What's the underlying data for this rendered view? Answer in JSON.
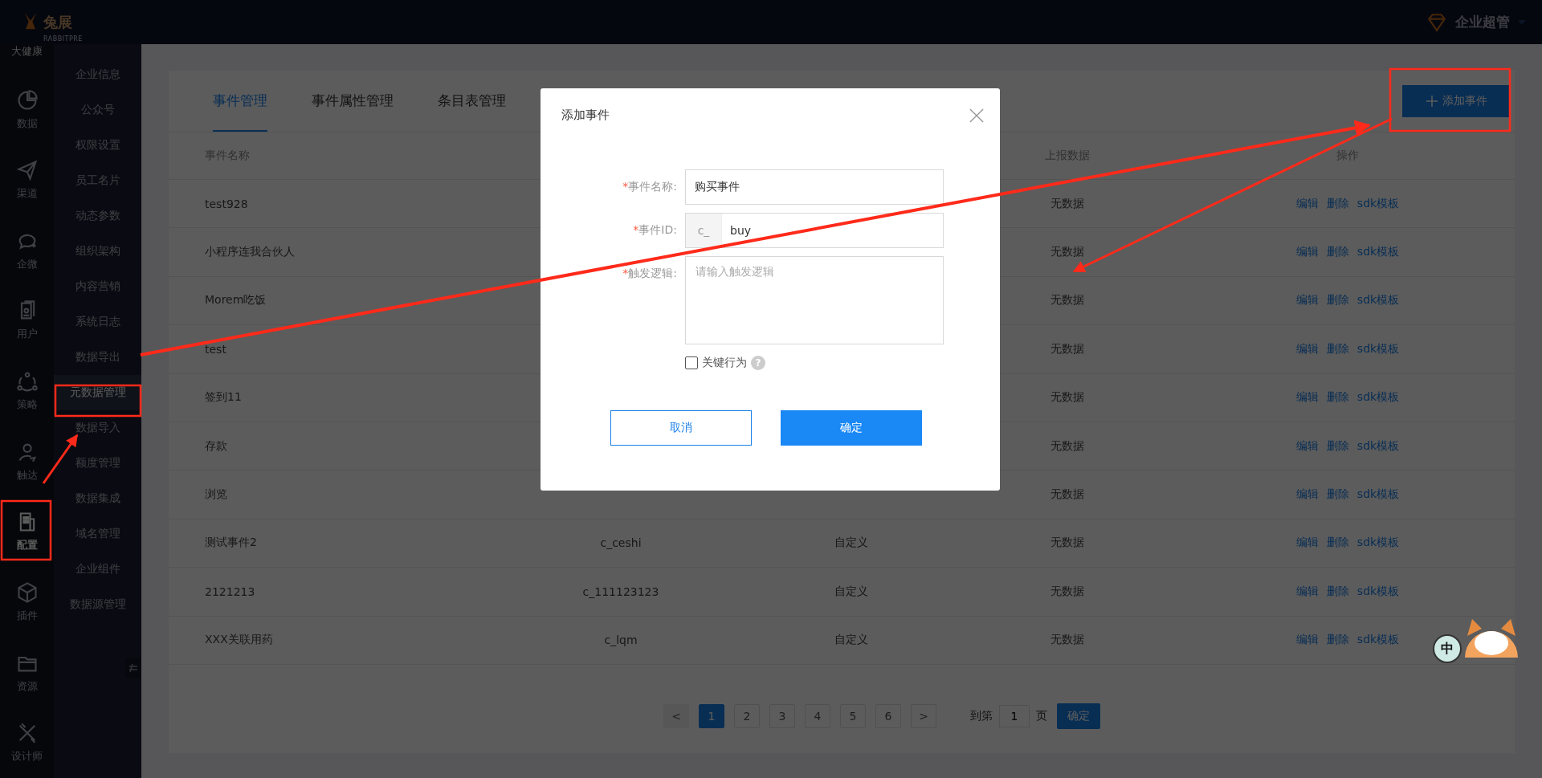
{
  "header": {
    "logo_text": "兔展",
    "logo_subtitle": "RABBITPRE",
    "org": "大健康",
    "user_role": "企业超管"
  },
  "rail": [
    {
      "label": "数据",
      "selected": false
    },
    {
      "label": "渠道",
      "selected": false
    },
    {
      "label": "企微",
      "selected": false
    },
    {
      "label": "用户",
      "selected": false
    },
    {
      "label": "策略",
      "selected": false
    },
    {
      "label": "触达",
      "selected": false
    },
    {
      "label": "配置",
      "selected": true
    },
    {
      "label": "插件",
      "selected": false
    },
    {
      "label": "资源",
      "selected": false
    },
    {
      "label": "设计师",
      "selected": false
    }
  ],
  "submenu": [
    {
      "label": "企业信息",
      "selected": false
    },
    {
      "label": "公众号",
      "selected": false
    },
    {
      "label": "权限设置",
      "selected": false
    },
    {
      "label": "员工名片",
      "selected": false
    },
    {
      "label": "动态参数",
      "selected": false
    },
    {
      "label": "组织架构",
      "selected": false
    },
    {
      "label": "内容营销",
      "selected": false
    },
    {
      "label": "系统日志",
      "selected": false
    },
    {
      "label": "数据导出",
      "selected": false
    },
    {
      "label": "元数据管理",
      "selected": true
    },
    {
      "label": "数据导入",
      "selected": false
    },
    {
      "label": "额度管理",
      "selected": false
    },
    {
      "label": "数据集成",
      "selected": false
    },
    {
      "label": "域名管理",
      "selected": false
    },
    {
      "label": "企业组件",
      "selected": false
    },
    {
      "label": "数据源管理",
      "selected": false
    }
  ],
  "tabs": [
    {
      "label": "事件管理",
      "selected": true
    },
    {
      "label": "事件属性管理",
      "selected": false
    },
    {
      "label": "条目表管理",
      "selected": false
    }
  ],
  "add_button": "添加事件",
  "table": {
    "columns": [
      "事件名称",
      "上报数据",
      "操作"
    ],
    "rows": [
      {
        "name": "test928",
        "report": "无数据",
        "actions": [
          "编辑",
          "删除",
          "sdk模板"
        ]
      },
      {
        "name": "小程序连我合伙人",
        "report": "无数据",
        "actions": [
          "编辑",
          "删除",
          "sdk模板"
        ]
      },
      {
        "name": "Morem吃饭",
        "report": "无数据",
        "actions": [
          "编辑",
          "删除",
          "sdk模板"
        ]
      },
      {
        "name": "test",
        "report": "无数据",
        "actions": [
          "编辑",
          "删除",
          "sdk模板"
        ]
      },
      {
        "name": "签到11",
        "report": "无数据",
        "actions": [
          "编辑",
          "删除",
          "sdk模板"
        ]
      },
      {
        "name": "存款",
        "report": "无数据",
        "actions": [
          "编辑",
          "删除",
          "sdk模板"
        ]
      },
      {
        "name": "浏览",
        "report": "无数据",
        "actions": [
          "编辑",
          "删除",
          "sdk模板"
        ]
      },
      {
        "name": "测试事件2",
        "event_id": "c_ceshi",
        "type": "自定义",
        "report": "无数据",
        "actions": [
          "编辑",
          "删除",
          "sdk模板"
        ]
      },
      {
        "name": "2121213",
        "event_id": "c_111123123",
        "type": "自定义",
        "report": "无数据",
        "actions": [
          "编辑",
          "删除",
          "sdk模板"
        ]
      },
      {
        "name": "XXX关联用药",
        "event_id": "c_lqm",
        "type": "自定义",
        "report": "无数据",
        "actions": [
          "编辑",
          "删除",
          "sdk模板"
        ]
      }
    ]
  },
  "pagination": {
    "prev": "<",
    "next": ">",
    "pages": [
      {
        "label": "1",
        "selected": true
      },
      {
        "label": "2",
        "selected": false
      },
      {
        "label": "3",
        "selected": false
      },
      {
        "label": "4",
        "selected": false
      },
      {
        "label": "5",
        "selected": false
      },
      {
        "label": "6",
        "selected": false
      }
    ],
    "goto_label": "到第",
    "goto_value": "1",
    "page_unit": "页",
    "confirm": "确定"
  },
  "modal": {
    "title": "添加事件",
    "fields": [
      {
        "kind": "text",
        "required": true,
        "required_mark": "*",
        "label": "事件名称:",
        "value": "购买事件"
      },
      {
        "kind": "prefixed",
        "required": true,
        "required_mark": "*",
        "label": "事件ID:",
        "prefix": "c_",
        "value": "buy"
      },
      {
        "kind": "textarea",
        "required": true,
        "required_mark": "*",
        "label": "触发逻辑:",
        "placeholder": "请输入触发逻辑"
      }
    ],
    "checkbox": {
      "label": "关键行为",
      "checked": false,
      "help": "?"
    },
    "cancel": "取消",
    "ok": "确定"
  },
  "ime_widget": {
    "label": "中"
  }
}
